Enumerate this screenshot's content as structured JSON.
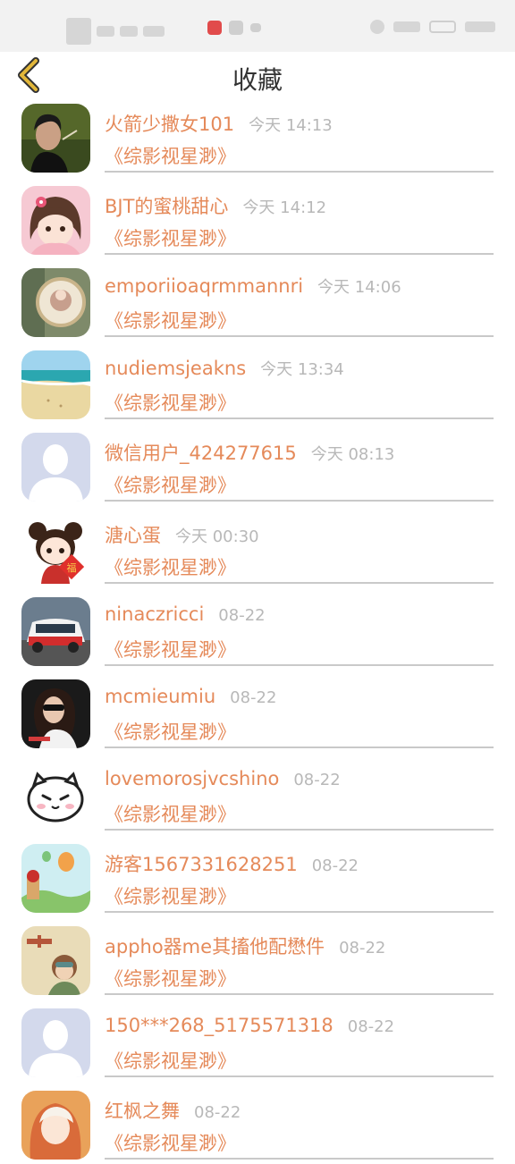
{
  "header": {
    "title": "收藏"
  },
  "items": [
    {
      "name": "火箭少撒女101",
      "time": "今天 14:13",
      "subtitle": "《综影视星渺》",
      "avatar": "photo-woman-avatar"
    },
    {
      "name": "BJT的蜜桃甜心",
      "time": "今天 14:12",
      "subtitle": "《综影视星渺》",
      "avatar": "cartoon-girl-avatar"
    },
    {
      "name": "emporiioaqrmmannri",
      "time": "今天 14:06",
      "subtitle": "《综影视星渺》",
      "avatar": "plate-photo-avatar"
    },
    {
      "name": "nudiemsjeakns",
      "time": "今天 13:34",
      "subtitle": "《综影视星渺》",
      "avatar": "beach-photo-avatar"
    },
    {
      "name": "微信用户_424277615",
      "time": "今天 08:13",
      "subtitle": "《综影视星渺》",
      "avatar": "default-avatar"
    },
    {
      "name": "溏心蛋",
      "time": "今天 00:30",
      "subtitle": "《综影视星渺》",
      "avatar": "cartoon-girl-avatar"
    },
    {
      "name": "ninaczricci",
      "time": "08-22",
      "subtitle": "《综影视星渺》",
      "avatar": "car-photo-avatar"
    },
    {
      "name": "mcmieumiu",
      "time": "08-22",
      "subtitle": "《综影视星渺》",
      "avatar": "woman-dark-photo-avatar"
    },
    {
      "name": "lovemorosjvcshino",
      "time": "08-22",
      "subtitle": "《综影视星渺》",
      "avatar": "cartoon-bear-avatar"
    },
    {
      "name": "游客1567331628251",
      "time": "08-22",
      "subtitle": "《综影视星渺》",
      "avatar": "balloon-illustration-avatar"
    },
    {
      "name": "appho器me其搐他配懋件",
      "time": "08-22",
      "subtitle": "《综影视星渺》",
      "avatar": "pilot-illustration-avatar"
    },
    {
      "name": "150***268_5175571318",
      "time": "08-22",
      "subtitle": "《综影视星渺》",
      "avatar": "default-avatar"
    },
    {
      "name": "红枫之舞",
      "time": "08-22",
      "subtitle": "《综影视星渺》",
      "avatar": "anime-girl-avatar"
    }
  ]
}
